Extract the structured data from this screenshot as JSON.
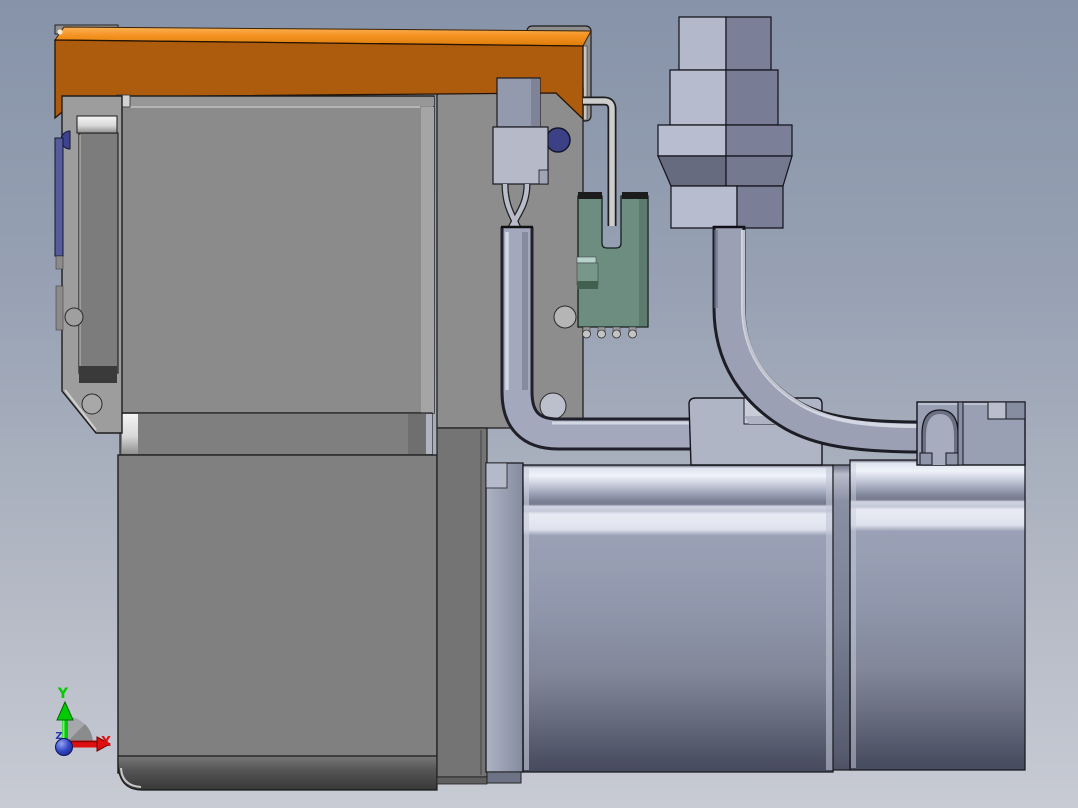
{
  "viewport": {
    "type": "cad-3d-view",
    "background_top": "#8793a9",
    "background_bottom": "#c8cbd4"
  },
  "triad": {
    "axes": [
      {
        "label": "Y",
        "color": "#00cc00"
      },
      {
        "label": "X",
        "color": "#e01010"
      },
      {
        "label": "Z",
        "color": "#2438b8"
      }
    ],
    "origin_sphere_color": "#1a2da0",
    "rotation_disc_color": "#8f8f8f"
  },
  "colors": {
    "bg_top": "#8793a9",
    "bg_bottom": "#c8cbd4",
    "orange_front": "#ad5c0d",
    "bracket": "#9d9d9d",
    "panel": "#8b8b8b",
    "housing": "#808080",
    "plate": "#8d8d8d",
    "wall": "#747474",
    "inner_panel": "#7c7c7c",
    "pcb_green": "#6e8d81",
    "pcb_green_dark": "#5c7a6e",
    "conn_light": "#b5b9c8",
    "conn_upper": "#949aae",
    "big_conn_light": "#b3b8cb",
    "big_conn_dark": "#7b8098",
    "cable": "#9ba0b4",
    "cable_small": "#a3a8bc",
    "motor_mid": "#8e94a9",
    "clamp": "#9aa0b3",
    "navy_hole": "#3c4084",
    "axis_y": "#00cc00",
    "axis_x": "#e01010",
    "axis_z": "#2438b8"
  },
  "parts": [
    {
      "name": "orange-mounting-bar",
      "color": "#ad5c0d"
    },
    {
      "name": "back-plate-strip",
      "color": "#8f8f8f"
    },
    {
      "name": "left-bracket",
      "color": "#9d9d9d"
    },
    {
      "name": "front-panel",
      "color": "#8b8b8b"
    },
    {
      "name": "lower-housing",
      "color": "#808080"
    },
    {
      "name": "mounting-plate",
      "color": "#8d8d8d"
    },
    {
      "name": "green-pcb-connector",
      "color": "#6e8d81"
    },
    {
      "name": "ground-wire",
      "color": "#cdcdcd"
    },
    {
      "name": "signal-connector",
      "color": "#b5b9c8"
    },
    {
      "name": "signal-cable",
      "color": "#a3a8bc"
    },
    {
      "name": "power-connector",
      "color": "#b3b8cb"
    },
    {
      "name": "power-cable",
      "color": "#9ba0b4"
    },
    {
      "name": "motor-front-flange",
      "color": "#99a0b2"
    },
    {
      "name": "motor-body",
      "color": "#8e94a9"
    },
    {
      "name": "motor-rear-housing",
      "color": "#8e94a9"
    },
    {
      "name": "cable-clamp-bracket",
      "color": "#9aa0b3"
    },
    {
      "name": "encoder-connector-block",
      "color": "#b0b5c6"
    }
  ]
}
